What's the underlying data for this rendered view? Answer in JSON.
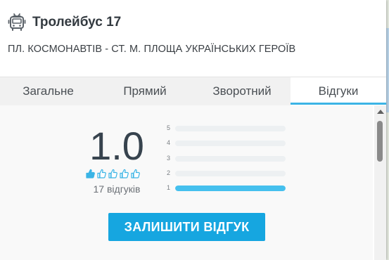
{
  "header": {
    "title": "Тролейбус 17",
    "route": "ПЛ. КОСМОНАВТІВ - СТ. М. ПЛОЩА УКРАЇНСЬКИХ ГЕРОЇВ",
    "icon": "trolleybus-icon"
  },
  "tabs": [
    {
      "label": "Загальне",
      "active": false
    },
    {
      "label": "Прямий",
      "active": false
    },
    {
      "label": "Зворотний",
      "active": false
    },
    {
      "label": "Відгуки",
      "active": true
    }
  ],
  "rating": {
    "value": "1.0",
    "stars_filled": 1,
    "stars_total": 5,
    "reviews_label": "17 відгуків",
    "distribution": [
      {
        "label": "5",
        "fraction": 0
      },
      {
        "label": "4",
        "fraction": 0
      },
      {
        "label": "3",
        "fraction": 0
      },
      {
        "label": "2",
        "fraction": 0
      },
      {
        "label": "1",
        "fraction": 1.0
      }
    ]
  },
  "actions": {
    "leave_review": "ЗАЛИШИТИ ВІДГУК"
  },
  "colors": {
    "accent": "#16a6e0",
    "bar_fill": "#45c0ee",
    "tab_underline": "#3bb4e5"
  }
}
